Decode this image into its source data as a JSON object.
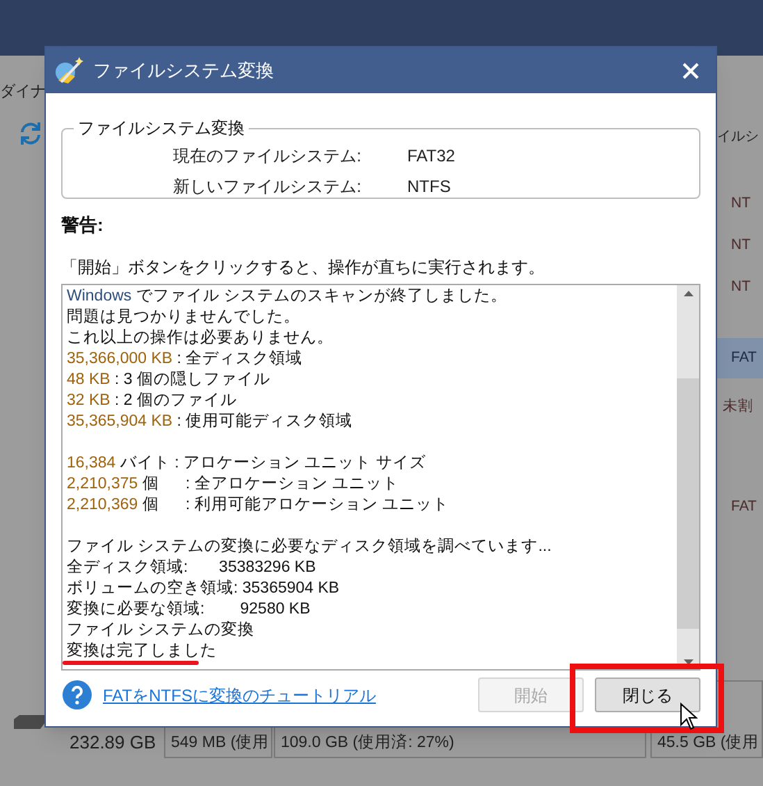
{
  "background_app": {
    "toolbar_label": "ダイナ",
    "column_header": "イルシ",
    "rows": [
      {
        "text": "NT",
        "selected": false
      },
      {
        "text": "NT",
        "selected": false
      },
      {
        "text": "NT",
        "selected": false
      },
      {
        "text": "FAT",
        "selected": true
      },
      {
        "text": "未割",
        "selected": false
      },
      {
        "text": "FAT",
        "selected": false
      }
    ],
    "disk": {
      "size": "232.89 GB",
      "partitions": [
        "549 MB (使用",
        "109.0 GB (使用済: 27%)",
        "45.5 GB (使用"
      ]
    }
  },
  "dialog": {
    "title": "ファイルシステム変換",
    "group": {
      "title": "ファイルシステム変換",
      "fields": [
        {
          "label": "現在のファイルシステム:",
          "value": "FAT32"
        },
        {
          "label": "新しいファイルシステム:",
          "value": "NTFS"
        }
      ]
    },
    "warning_title": "警告:",
    "warning_text": "「開始」ボタンをクリックすると、操作が直ちに実行されます。",
    "log": [
      {
        "kind": "text",
        "segments": [
          {
            "text": "Windows",
            "kind": "keyword"
          },
          {
            "text": " でファイル システムのスキャンが終了しました。",
            "kind": "plain"
          }
        ]
      },
      {
        "kind": "text",
        "segments": [
          {
            "text": "問題は見つかりませんでした。",
            "kind": "plain"
          }
        ]
      },
      {
        "kind": "text",
        "segments": [
          {
            "text": "これ以上の操作は必要ありません。",
            "kind": "plain"
          }
        ]
      },
      {
        "kind": "text",
        "segments": [
          {
            "text": "35,366,000 KB",
            "kind": "number"
          },
          {
            "text": " : 全ディスク領域",
            "kind": "plain"
          }
        ]
      },
      {
        "kind": "text",
        "segments": [
          {
            "text": "48 KB",
            "kind": "number"
          },
          {
            "text": " : 3 個の隠しファイル",
            "kind": "plain"
          }
        ]
      },
      {
        "kind": "text",
        "segments": [
          {
            "text": "32 KB",
            "kind": "number"
          },
          {
            "text": " : 2 個のファイル",
            "kind": "plain"
          }
        ]
      },
      {
        "kind": "text",
        "segments": [
          {
            "text": "35,365,904 KB",
            "kind": "number"
          },
          {
            "text": " : 使用可能ディスク領域",
            "kind": "plain"
          }
        ]
      },
      {
        "kind": "blank"
      },
      {
        "kind": "text",
        "segments": [
          {
            "text": "16,384",
            "kind": "number"
          },
          {
            "text": " バイト : アロケーション ユニット サイズ",
            "kind": "plain"
          }
        ]
      },
      {
        "kind": "text",
        "segments": [
          {
            "text": "2,210,375",
            "kind": "number"
          },
          {
            "text": " 個      : 全アロケーション ユニット",
            "kind": "plain"
          }
        ]
      },
      {
        "kind": "text",
        "segments": [
          {
            "text": "2,210,369",
            "kind": "number"
          },
          {
            "text": " 個      : 利用可能アロケーション ユニット",
            "kind": "plain"
          }
        ]
      },
      {
        "kind": "blank"
      },
      {
        "kind": "text",
        "segments": [
          {
            "text": "ファイル システムの変換に必要なディスク領域を調べています...",
            "kind": "plain"
          }
        ]
      },
      {
        "kind": "text",
        "segments": [
          {
            "text": "全ディスク領域:       35383296 KB",
            "kind": "plain"
          }
        ]
      },
      {
        "kind": "text",
        "segments": [
          {
            "text": "ボリュームの空き領域: 35365904 KB",
            "kind": "plain"
          }
        ]
      },
      {
        "kind": "text",
        "segments": [
          {
            "text": "変換に必要な領域:        92580 KB",
            "kind": "plain"
          }
        ]
      },
      {
        "kind": "text",
        "segments": [
          {
            "text": "ファイル システムの変換",
            "kind": "plain"
          }
        ]
      },
      {
        "kind": "text",
        "segments": [
          {
            "text": "変換は完了しました",
            "kind": "plain"
          }
        ]
      }
    ],
    "tutorial_link": "FATをNTFSに変換のチュートリアル",
    "buttons": [
      {
        "label": "開始",
        "disabled": true
      },
      {
        "label": "閉じる",
        "disabled": false
      }
    ]
  }
}
